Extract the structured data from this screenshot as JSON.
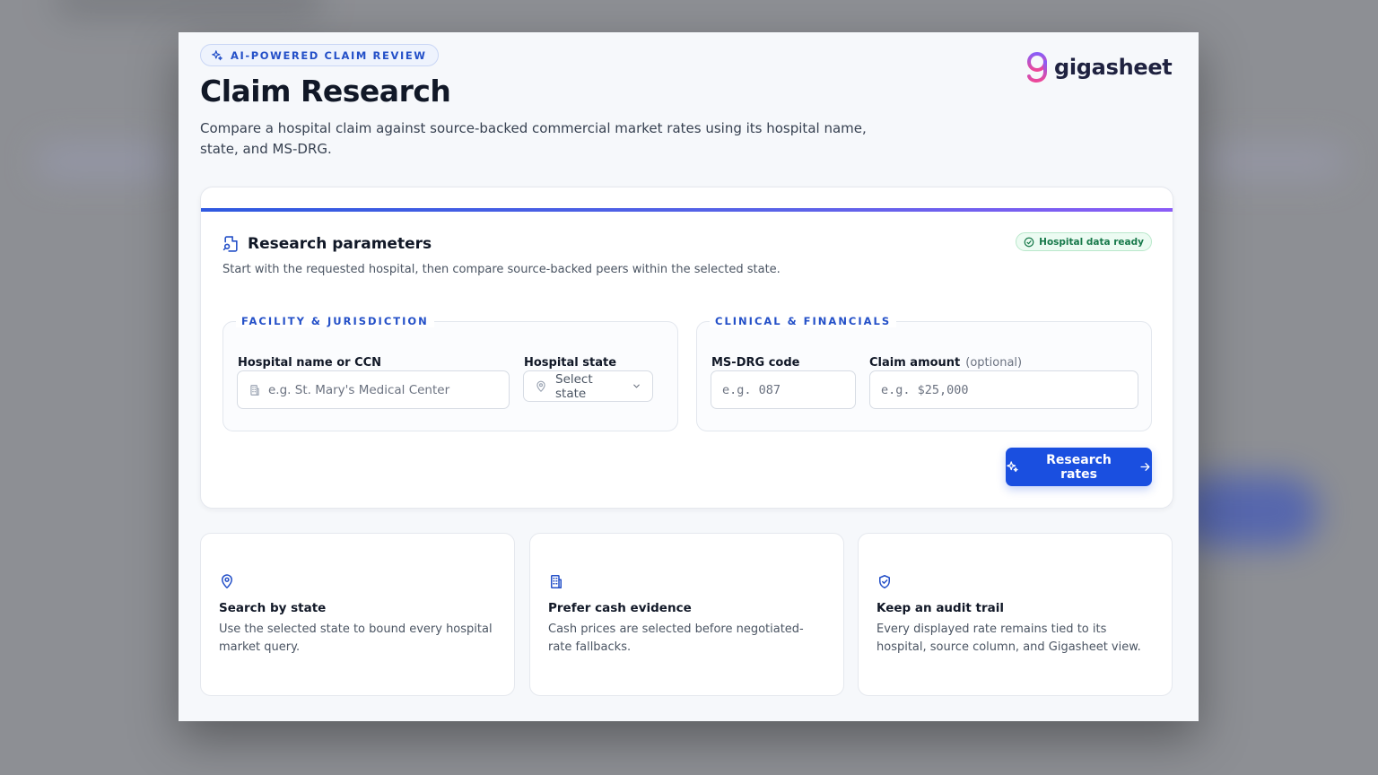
{
  "header": {
    "eyebrow": "AI-POWERED CLAIM REVIEW",
    "title": "Claim Research",
    "description": "Compare a hospital claim against source-backed commercial market rates using its hospital name, state, and MS-DRG.",
    "logo_text": "gigasheet"
  },
  "form": {
    "title": "Research parameters",
    "subtitle": "Start with the requested hospital, then compare source-backed peers within the selected state.",
    "status_badge": "Hospital data ready",
    "facility": {
      "legend": "FACILITY & JURISDICTION",
      "hospital_label": "Hospital name or CCN",
      "hospital_value": "",
      "hospital_placeholder": "e.g. St. Mary's Medical Center",
      "state_label": "Hospital state",
      "state_value": "Select state"
    },
    "clinical": {
      "legend": "CLINICAL & FINANCIALS",
      "drg_label": "MS-DRG code",
      "drg_value": "",
      "drg_placeholder": "e.g. 087",
      "amount_label": "Claim amount",
      "amount_optional": "(optional)",
      "amount_value": "",
      "amount_placeholder": "e.g. $25,000"
    },
    "submit_label": "Research rates"
  },
  "features": [
    {
      "icon": "map-pin-icon",
      "title": "Search by state",
      "description": "Use the selected state to bound every hospital market query."
    },
    {
      "icon": "building-icon",
      "title": "Prefer cash evidence",
      "description": "Cash prices are selected before negotiated-rate fallbacks."
    },
    {
      "icon": "shield-check-icon",
      "title": "Keep an audit trail",
      "description": "Every displayed rate remains tied to its hospital, source column, and Gigasheet view."
    }
  ],
  "colors": {
    "accent": "#1a4fe0",
    "eyebrow_text": "#2450c8",
    "success": "#17794a",
    "logo_gradient_start": "#8b5cf6",
    "logo_gradient_end": "#ec4899"
  }
}
